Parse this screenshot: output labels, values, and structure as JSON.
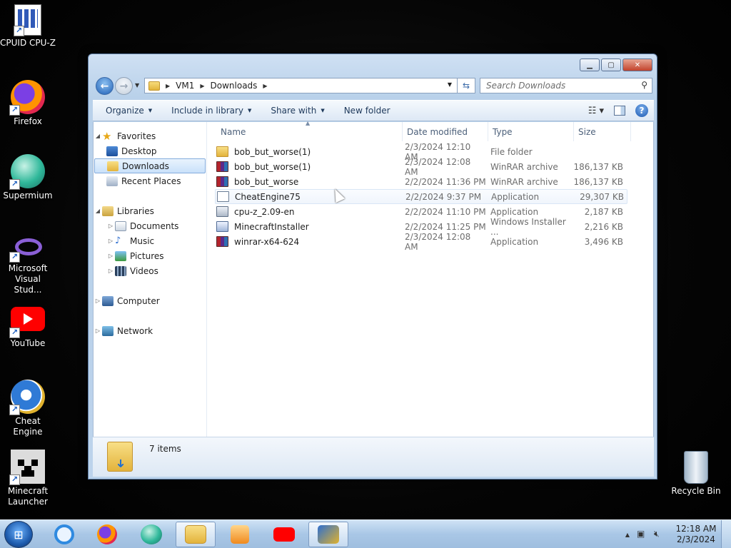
{
  "desktop": {
    "icons": [
      {
        "label": "CPUID CPU-Z",
        "icon": "cpuz-icon"
      },
      {
        "label": "Firefox",
        "icon": "firefox-icon"
      },
      {
        "label": "Supermium",
        "icon": "supermium-icon"
      },
      {
        "label": "Microsoft Visual Stud...",
        "icon": "visual-studio-icon"
      },
      {
        "label": "YouTube",
        "icon": "youtube-icon"
      },
      {
        "label": "Cheat Engine",
        "icon": "cheat-engine-icon"
      },
      {
        "label": "Minecraft Launcher",
        "icon": "minecraft-icon"
      },
      {
        "label": "Recycle Bin",
        "icon": "recycle-bin-icon"
      }
    ]
  },
  "window": {
    "address": {
      "root": "VM1",
      "current": "Downloads"
    },
    "search_placeholder": "Search Downloads",
    "toolbar": {
      "organize": "Organize",
      "include_in_library": "Include in library",
      "share_with": "Share with",
      "new_folder": "New folder"
    },
    "nav": {
      "favorites": "Favorites",
      "desktop": "Desktop",
      "downloads": "Downloads",
      "recent_places": "Recent Places",
      "libraries": "Libraries",
      "documents": "Documents",
      "music": "Music",
      "pictures": "Pictures",
      "videos": "Videos",
      "computer": "Computer",
      "network": "Network"
    },
    "columns": {
      "name": "Name",
      "date": "Date modified",
      "type": "Type",
      "size": "Size"
    },
    "files": [
      {
        "name": "bob_but_worse(1)",
        "date": "2/3/2024 12:10 AM",
        "type": "File folder",
        "size": "",
        "icon": "folder-icon"
      },
      {
        "name": "bob_but_worse(1)",
        "date": "2/3/2024 12:08 AM",
        "type": "WinRAR archive",
        "size": "186,137 KB",
        "icon": "winrar-archive-icon"
      },
      {
        "name": "bob_but_worse",
        "date": "2/2/2024 11:36 PM",
        "type": "WinRAR archive",
        "size": "186,137 KB",
        "icon": "winrar-archive-icon"
      },
      {
        "name": "CheatEngine75",
        "date": "2/2/2024 9:37 PM",
        "type": "Application",
        "size": "29,307 KB",
        "icon": "installer-icon"
      },
      {
        "name": "cpu-z_2.09-en",
        "date": "2/2/2024 11:10 PM",
        "type": "Application",
        "size": "2,187 KB",
        "icon": "application-icon"
      },
      {
        "name": "MinecraftInstaller",
        "date": "2/2/2024 11:25 PM",
        "type": "Windows Installer ...",
        "size": "2,216 KB",
        "icon": "msi-icon"
      },
      {
        "name": "winrar-x64-624",
        "date": "2/3/2024 12:08 AM",
        "type": "Application",
        "size": "3,496 KB",
        "icon": "winrar-setup-icon"
      }
    ],
    "status": {
      "item_count": "7 items"
    }
  },
  "taskbar": {
    "clock_time": "12:18 AM",
    "clock_date": "2/3/2024",
    "apps": [
      "internet-explorer-icon",
      "firefox-icon",
      "supermium-icon",
      "explorer-icon",
      "media-player-icon",
      "youtube-icon",
      "cheat-engine-icon"
    ]
  },
  "colors": {
    "accent": "#1f5fb6",
    "window_frame": "#b9d1ea",
    "taskbar": "#a9c7e6"
  }
}
